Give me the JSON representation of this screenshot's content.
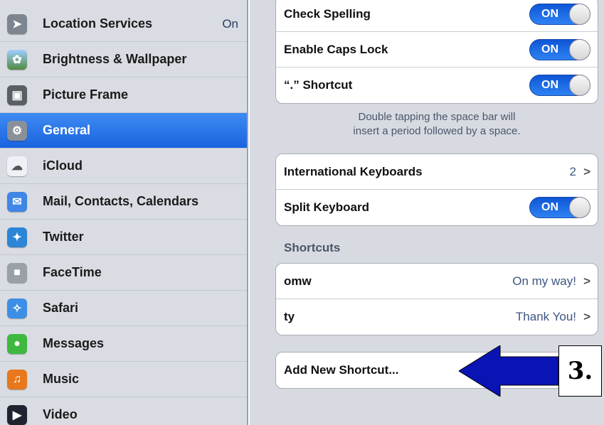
{
  "sidebar": {
    "items": [
      {
        "label": "Location Services",
        "value": "On",
        "icon": "location-icon",
        "icon_color": "#7d8591"
      },
      {
        "label": "Brightness & Wallpaper",
        "icon": "wallpaper-icon",
        "icon_color": "#4f8a3f"
      },
      {
        "label": "Picture Frame",
        "icon": "picture-frame-icon",
        "icon_color": "#5a5f66"
      },
      {
        "label": "General",
        "icon": "gear-icon",
        "icon_color": "#8a9099",
        "selected": true
      },
      {
        "label": "iCloud",
        "icon": "cloud-icon",
        "icon_color": "#eef1f5"
      },
      {
        "label": "Mail, Contacts, Calendars",
        "icon": "mail-icon",
        "icon_color": "#3f86e6"
      },
      {
        "label": "Twitter",
        "icon": "twitter-icon",
        "icon_color": "#2c85d6"
      },
      {
        "label": "FaceTime",
        "icon": "facetime-icon",
        "icon_color": "#9aa0a8"
      },
      {
        "label": "Safari",
        "icon": "safari-icon",
        "icon_color": "#3d8fe6"
      },
      {
        "label": "Messages",
        "icon": "messages-icon",
        "icon_color": "#3fb83f"
      },
      {
        "label": "Music",
        "icon": "music-icon",
        "icon_color": "#e8781c"
      },
      {
        "label": "Video",
        "icon": "video-icon",
        "icon_color": "#1d2430"
      }
    ]
  },
  "main": {
    "group1": [
      {
        "label": "Check Spelling",
        "toggle": "ON"
      },
      {
        "label": "Enable Caps Lock",
        "toggle": "ON"
      },
      {
        "label": "“.” Shortcut",
        "toggle": "ON"
      }
    ],
    "footnote_line1": "Double tapping the space bar will",
    "footnote_line2": "insert a period followed by a space.",
    "group2": [
      {
        "label": "International Keyboards",
        "value": "2"
      },
      {
        "label": "Split Keyboard",
        "toggle": "ON"
      }
    ],
    "shortcuts_header": "Shortcuts",
    "shortcuts": [
      {
        "label": "omw",
        "value": "On my way!"
      },
      {
        "label": "ty",
        "value": "Thank You!"
      }
    ],
    "add_shortcut_label": "Add New Shortcut...",
    "chevron": ">"
  },
  "annotation": {
    "step_label": "3.",
    "arrow_color": "#0a14b4"
  }
}
